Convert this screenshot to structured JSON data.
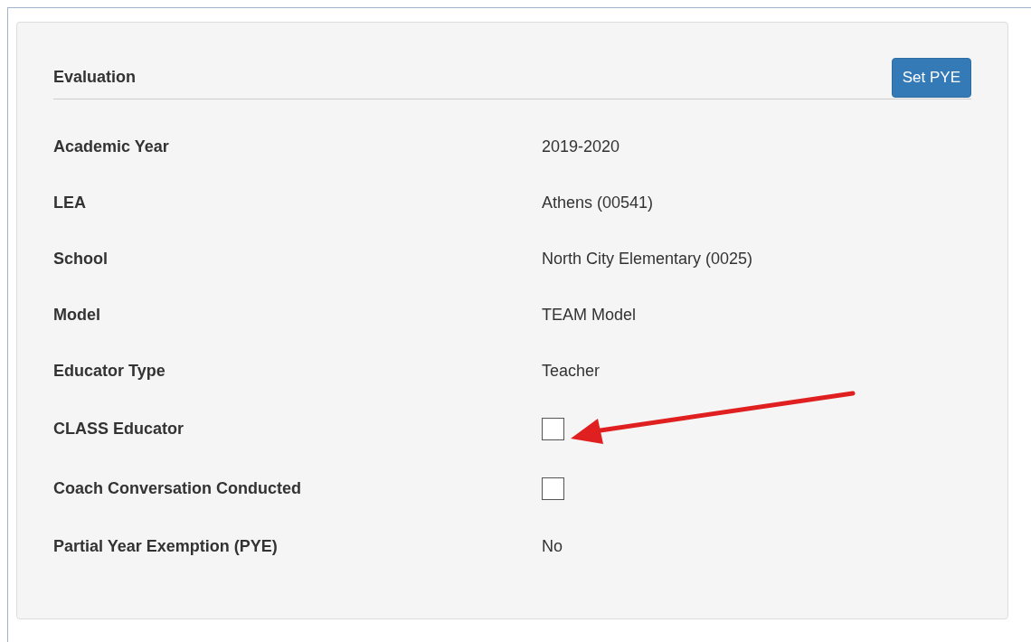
{
  "panel": {
    "title": "Evaluation",
    "button": "Set PYE"
  },
  "rows": [
    {
      "kind": "text",
      "label": "Academic Year",
      "value": "2019-2020"
    },
    {
      "kind": "text",
      "label": "LEA",
      "value": "Athens (00541)"
    },
    {
      "kind": "text",
      "label": "School",
      "value": "North City Elementary (0025)"
    },
    {
      "kind": "text",
      "label": "Model",
      "value": "TEAM Model"
    },
    {
      "kind": "text",
      "label": "Educator Type",
      "value": "Teacher"
    },
    {
      "kind": "checkbox",
      "label": "CLASS Educator",
      "checked": false
    },
    {
      "kind": "checkbox",
      "label": "Coach Conversation Conducted",
      "checked": false
    },
    {
      "kind": "text",
      "label": "Partial Year Exemption (PYE)",
      "value": "No"
    }
  ]
}
